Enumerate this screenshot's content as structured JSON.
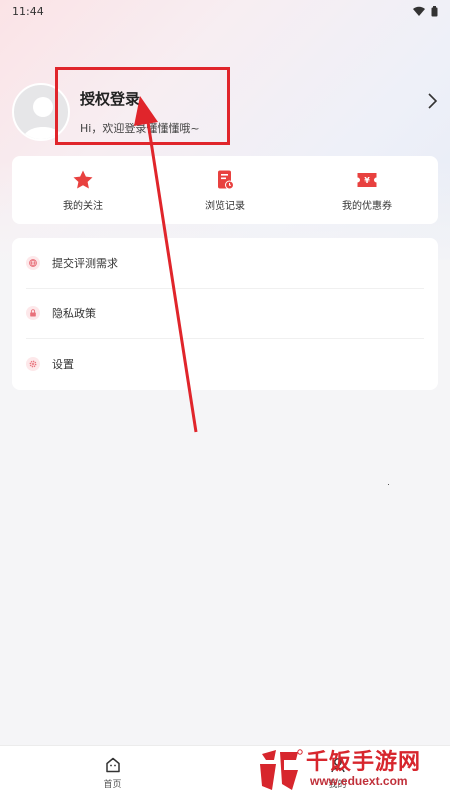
{
  "status_bar": {
    "time": "11:44"
  },
  "profile": {
    "title": "授权登录",
    "subtitle": "Hi，欢迎登录懂懂懂哦~"
  },
  "quick_links": [
    {
      "label": "我的关注",
      "icon": "star-icon"
    },
    {
      "label": "浏览记录",
      "icon": "history-icon"
    },
    {
      "label": "我的优惠券",
      "icon": "coupon-icon"
    }
  ],
  "menu": [
    {
      "label": "提交评测需求",
      "icon": "globe-icon"
    },
    {
      "label": "隐私政策",
      "icon": "lock-icon"
    },
    {
      "label": "设置",
      "icon": "gear-icon"
    }
  ],
  "bottom_nav": [
    {
      "label": "首页",
      "icon": "home-icon"
    },
    {
      "label": "我的",
      "icon": "user-icon"
    }
  ],
  "watermark": {
    "title": "千饭手游网",
    "url": "www.eduext.com"
  },
  "colors": {
    "accent": "#e0252b",
    "brand_red": "#d7262d",
    "background": "#f5f5f7"
  }
}
